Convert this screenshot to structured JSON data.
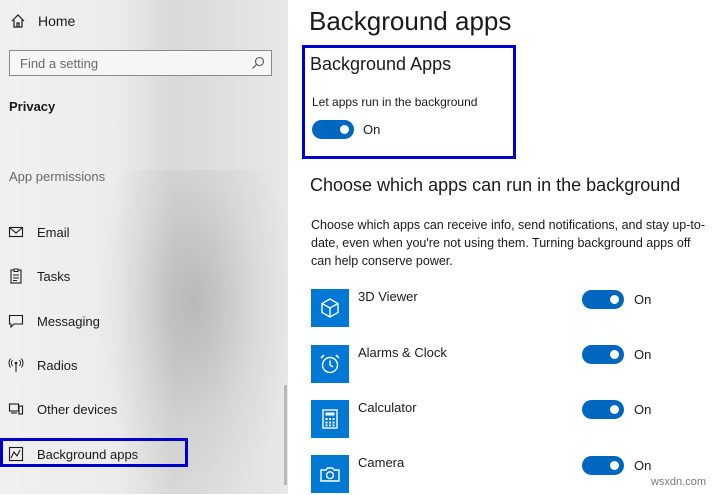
{
  "sidebar": {
    "home_label": "Home",
    "search_placeholder": "Find a setting",
    "section_title": "Privacy",
    "permissions_label": "App permissions",
    "items": [
      {
        "label": "Email",
        "icon": "mail-icon"
      },
      {
        "label": "Tasks",
        "icon": "tasks-icon"
      },
      {
        "label": "Messaging",
        "icon": "message-icon"
      },
      {
        "label": "Radios",
        "icon": "radio-tower-icon"
      },
      {
        "label": "Other devices",
        "icon": "devices-icon"
      },
      {
        "label": "Background apps",
        "icon": "background-apps-icon",
        "selected": true
      }
    ]
  },
  "main": {
    "page_title": "Background apps",
    "background_apps": {
      "heading": "Background Apps",
      "description": "Let apps run in the background",
      "toggle_state": "On",
      "toggle_on": true
    },
    "choose": {
      "heading": "Choose which apps can run in the background",
      "description": "Choose which apps can receive info, send notifications, and stay up-to-date, even when you're not using them. Turning background apps off can help conserve power."
    },
    "apps": [
      {
        "name": "3D Viewer",
        "state": "On",
        "on": true,
        "icon": "cube-icon"
      },
      {
        "name": "Alarms & Clock",
        "state": "On",
        "on": true,
        "icon": "alarm-clock-icon"
      },
      {
        "name": "Calculator",
        "state": "On",
        "on": true,
        "icon": "calculator-icon"
      },
      {
        "name": "Camera",
        "state": "On",
        "on": true,
        "icon": "camera-icon"
      }
    ]
  },
  "watermark": "wsxdn.com",
  "colors": {
    "accent": "#0078d4",
    "toggle": "#0067c0",
    "highlight_border": "#0000cc"
  }
}
